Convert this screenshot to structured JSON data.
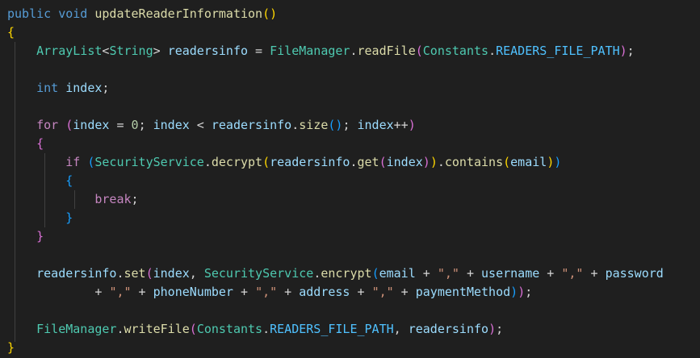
{
  "editor": {
    "language": "java",
    "colors": {
      "background": "#1f1f1f",
      "plain": "#d4d4d4",
      "keyword": "#569cd6",
      "control": "#c586c0",
      "type": "#4ec9b0",
      "function": "#dcdcaa",
      "variable": "#9cdcfe",
      "constant": "#4fc1ff",
      "number": "#b5cea8",
      "string": "#ce9178",
      "bracket_1": "#ffd700",
      "bracket_2": "#da70d6",
      "bracket_3": "#179fff"
    },
    "lines": [
      [
        [
          "kw",
          "public"
        ],
        [
          "plain",
          " "
        ],
        [
          "kw",
          "void"
        ],
        [
          "plain",
          " "
        ],
        [
          "fn",
          "updateReaderInformation"
        ],
        [
          "b1",
          "()"
        ]
      ],
      [
        [
          "b1",
          "{"
        ]
      ],
      [
        [
          "plain",
          "    "
        ],
        [
          "type",
          "ArrayList"
        ],
        [
          "plain",
          "<"
        ],
        [
          "type",
          "String"
        ],
        [
          "plain",
          "> "
        ],
        [
          "var",
          "readersinfo"
        ],
        [
          "plain",
          " = "
        ],
        [
          "type",
          "FileManager"
        ],
        [
          "plain",
          "."
        ],
        [
          "fn",
          "readFile"
        ],
        [
          "b2",
          "("
        ],
        [
          "type",
          "Constants"
        ],
        [
          "plain",
          "."
        ],
        [
          "const",
          "READERS_FILE_PATH"
        ],
        [
          "b2",
          ")"
        ],
        [
          "plain",
          ";"
        ]
      ],
      [],
      [
        [
          "plain",
          "    "
        ],
        [
          "kw",
          "int"
        ],
        [
          "plain",
          " "
        ],
        [
          "var",
          "index"
        ],
        [
          "plain",
          ";"
        ]
      ],
      [],
      [
        [
          "plain",
          "    "
        ],
        [
          "ctrl",
          "for"
        ],
        [
          "plain",
          " "
        ],
        [
          "b2",
          "("
        ],
        [
          "var",
          "index"
        ],
        [
          "plain",
          " = "
        ],
        [
          "num",
          "0"
        ],
        [
          "plain",
          "; "
        ],
        [
          "var",
          "index"
        ],
        [
          "plain",
          " < "
        ],
        [
          "var",
          "readersinfo"
        ],
        [
          "plain",
          "."
        ],
        [
          "fn",
          "size"
        ],
        [
          "b3",
          "()"
        ],
        [
          "plain",
          "; "
        ],
        [
          "var",
          "index"
        ],
        [
          "plain",
          "++"
        ],
        [
          "b2",
          ")"
        ]
      ],
      [
        [
          "plain",
          "    "
        ],
        [
          "b2",
          "{"
        ]
      ],
      [
        [
          "plain",
          "        "
        ],
        [
          "ctrl",
          "if"
        ],
        [
          "plain",
          " "
        ],
        [
          "b3",
          "("
        ],
        [
          "type",
          "SecurityService"
        ],
        [
          "plain",
          "."
        ],
        [
          "fn",
          "decrypt"
        ],
        [
          "b1",
          "("
        ],
        [
          "var",
          "readersinfo"
        ],
        [
          "plain",
          "."
        ],
        [
          "fn",
          "get"
        ],
        [
          "b2",
          "("
        ],
        [
          "var",
          "index"
        ],
        [
          "b2",
          ")"
        ],
        [
          "b1",
          ")"
        ],
        [
          "plain",
          "."
        ],
        [
          "fn",
          "contains"
        ],
        [
          "b1",
          "("
        ],
        [
          "var",
          "email"
        ],
        [
          "b1",
          ")"
        ],
        [
          "b3",
          ")"
        ]
      ],
      [
        [
          "plain",
          "        "
        ],
        [
          "b3",
          "{"
        ]
      ],
      [
        [
          "plain",
          "            "
        ],
        [
          "ctrl",
          "break"
        ],
        [
          "plain",
          ";"
        ]
      ],
      [
        [
          "plain",
          "        "
        ],
        [
          "b3",
          "}"
        ]
      ],
      [
        [
          "plain",
          "    "
        ],
        [
          "b2",
          "}"
        ]
      ],
      [],
      [
        [
          "plain",
          "    "
        ],
        [
          "var",
          "readersinfo"
        ],
        [
          "plain",
          "."
        ],
        [
          "fn",
          "set"
        ],
        [
          "b2",
          "("
        ],
        [
          "var",
          "index"
        ],
        [
          "plain",
          ", "
        ],
        [
          "type",
          "SecurityService"
        ],
        [
          "plain",
          "."
        ],
        [
          "fn",
          "encrypt"
        ],
        [
          "b3",
          "("
        ],
        [
          "var",
          "email"
        ],
        [
          "plain",
          " + "
        ],
        [
          "str",
          "\",\""
        ],
        [
          "plain",
          " + "
        ],
        [
          "var",
          "username"
        ],
        [
          "plain",
          " + "
        ],
        [
          "str",
          "\",\""
        ],
        [
          "plain",
          " + "
        ],
        [
          "var",
          "password"
        ]
      ],
      [
        [
          "plain",
          "            + "
        ],
        [
          "str",
          "\",\""
        ],
        [
          "plain",
          " + "
        ],
        [
          "var",
          "phoneNumber"
        ],
        [
          "plain",
          " + "
        ],
        [
          "str",
          "\",\""
        ],
        [
          "plain",
          " + "
        ],
        [
          "var",
          "address"
        ],
        [
          "plain",
          " + "
        ],
        [
          "str",
          "\",\""
        ],
        [
          "plain",
          " + "
        ],
        [
          "var",
          "paymentMethod"
        ],
        [
          "b3",
          ")"
        ],
        [
          "b2",
          ")"
        ],
        [
          "plain",
          ";"
        ]
      ],
      [],
      [
        [
          "plain",
          "    "
        ],
        [
          "type",
          "FileManager"
        ],
        [
          "plain",
          "."
        ],
        [
          "fn",
          "writeFile"
        ],
        [
          "b2",
          "("
        ],
        [
          "type",
          "Constants"
        ],
        [
          "plain",
          "."
        ],
        [
          "const",
          "READERS_FILE_PATH"
        ],
        [
          "plain",
          ", "
        ],
        [
          "var",
          "readersinfo"
        ],
        [
          "b2",
          ")"
        ],
        [
          "plain",
          ";"
        ]
      ],
      [
        [
          "b1",
          "}"
        ]
      ]
    ]
  }
}
